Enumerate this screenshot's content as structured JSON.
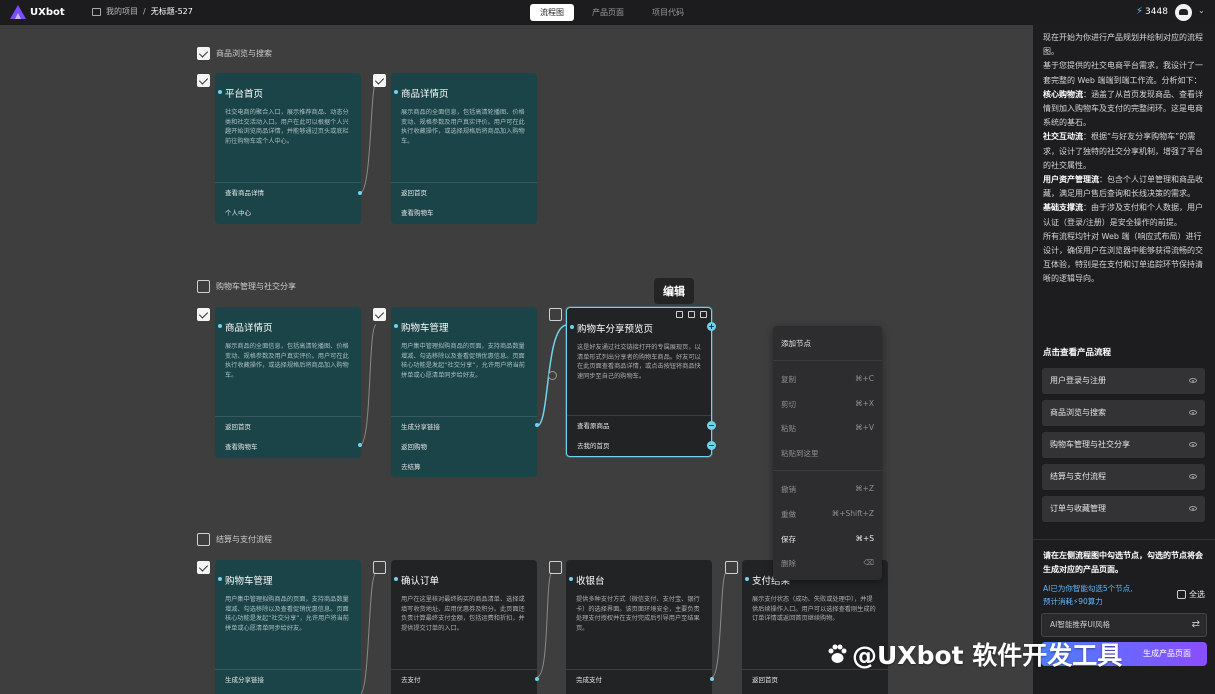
{
  "app": {
    "name": "UXbot",
    "credits": "3448"
  },
  "breadcrumb": {
    "project": "我的项目",
    "separator": "/",
    "title": "无标题-527"
  },
  "tabs": [
    {
      "label": "流程图",
      "active": true
    },
    {
      "label": "产品页面",
      "active": false
    },
    {
      "label": "项目代码",
      "active": false
    }
  ],
  "groups": {
    "g1": "商品浏览与搜索",
    "g2": "购物车管理与社交分享",
    "g3": "结算与支付流程"
  },
  "nodes": {
    "n1": {
      "title": "平台首页",
      "desc": "社交电商的聚合入口，展示推荐商品、动态分类和社交活动入口。用户在此可以根据个人兴趣开始浏览商品详情，并能够通过页头或底栏前往购物车或个人中心。",
      "actions": [
        "查看商品详情",
        "个人中心"
      ]
    },
    "n2": {
      "title": "商品详情页",
      "desc": "展示商品的全面信息，包括高清轮播图、价格变动、规格参数及用户真实评价。用户可在此执行收藏操作，或选择规格后将商品加入购物车。",
      "actions": [
        "返回首页",
        "查看购物车"
      ]
    },
    "n3": {
      "title": "商品详情页",
      "desc": "展示商品的全面信息，包括高清轮播图、价格变动、规格参数及用户真实评价。用户可在此执行收藏操作，或选择规格后将商品加入购物车。",
      "actions": [
        "返回首页",
        "查看购物车"
      ]
    },
    "n4": {
      "title": "购物车管理",
      "desc": "用户集中管理拟购商品的页面，支持商品数量增减、勾选移除以及查看促销优惠信息。页面核心功能是发起“社交分享”，允许用户将当前拼单或心愿清单同步给好友。",
      "actions": [
        "生成分享链接",
        "返回购物",
        "去结算"
      ]
    },
    "n5": {
      "title": "购物车分享预览页",
      "desc": "这是好友通过社交链接打开的专属展现页，以清单形式列出分享者的购物车商品。好友可以在此页面查看商品详情，或点击按钮将商品快速同步至自己的购物车。",
      "actions": [
        "查看原商品",
        "去我的首页"
      ]
    },
    "n6": {
      "title": "购物车管理",
      "desc": "用户集中管理拟购商品的页面，支持商品数量增减、勾选移除以及查看促销优惠信息。页面核心功能是发起“社交分享”，允许用户将当前拼单或心愿清单同步给好友。",
      "actions": [
        "生成分享链接"
      ]
    },
    "n7": {
      "title": "确认订单",
      "desc": "用户在这里核对最终购买的商品清单、选择或填写收货地址、应用优惠券及积分。此页面还负责计算最终支付金额，包括运费和折扣，并提供提交订单的入口。",
      "actions": [
        "去支付"
      ]
    },
    "n8": {
      "title": "收银台",
      "desc": "提供多种支付方式（微信支付、支付宝、银行卡）的选择界面。该页面环境安全，主要负责处理支付授权并在支付完成后引导用户至结果页。",
      "actions": [
        "完成支付"
      ]
    },
    "n9": {
      "title": "支付结果",
      "desc": "展示支付状态（成功、失败或处理中），并提供后续操作入口。用户可以选择查看刚生成的订单详情或返回首页继续购物。",
      "actions": [
        "返回首页"
      ]
    }
  },
  "tooltip": "编辑",
  "context_menu": [
    {
      "label": "添加节点",
      "shortcut": "",
      "enabled": true
    },
    {
      "label": "复制",
      "shortcut": "⌘+C",
      "enabled": false
    },
    {
      "label": "剪切",
      "shortcut": "⌘+X",
      "enabled": false
    },
    {
      "label": "粘贴",
      "shortcut": "⌘+V",
      "enabled": false
    },
    {
      "label": "粘贴到这里",
      "shortcut": "",
      "enabled": false
    },
    {
      "label": "撤销",
      "shortcut": "⌘+Z",
      "enabled": false
    },
    {
      "label": "重做",
      "shortcut": "⌘+Shift+Z",
      "enabled": false
    },
    {
      "label": "保存",
      "shortcut": "⌘+S",
      "enabled": true
    },
    {
      "label": "删除",
      "shortcut": "⌫",
      "enabled": false
    }
  ],
  "panel": {
    "p1": "现在开始为你进行产品规划并绘制对应的流程图。",
    "p2": "基于您提供的社交电商平台需求，我设计了一套完整的 Web 端端到端工作流。分析如下：",
    "core_label": "核心购物流",
    "core_text": "：涵盖了从首页发现商品、查看详情到加入购物车及支付的完整闭环。这是电商系统的基石。",
    "social_label": "社交互动流",
    "social_text": "：根据“与好友分享购物车”的需求，设计了独特的社交分享机制，增强了平台的社交属性。",
    "asset_label": "用户资产管理流",
    "asset_text": "：包含个人订单管理和商品收藏，满足用户售后查询和长线决策的需求。",
    "base_label": "基础支撑流",
    "base_text": "：由于涉及支付和个人数据，用户认证（登录/注册）是安全操作的前提。",
    "p3": "所有流程均针对 Web 端（响应式布局）进行设计，确保用户在浏览器中能够获得流畅的交互体验，特别是在支付和订单追踪环节保持清晰的逻辑导向。",
    "flow_head": "点击查看产品流程",
    "flows": [
      "用户登录与注册",
      "商品浏览与搜索",
      "购物车管理与社交分享",
      "结算与支付流程",
      "订单与收藏管理"
    ],
    "hint": "请在左侧流程图中勾选节点，勾选的节点将会生成对应的产品页面。",
    "ai_line1": "AI已为你智能勾选5个节点,",
    "ai_line2": "预计消耗⚡90算力",
    "select_all": "全选",
    "style_placeholder": "AI智能推荐UI风格",
    "gen_button": "生成产品页面"
  },
  "watermark": "@UXbot 软件开发工具"
}
